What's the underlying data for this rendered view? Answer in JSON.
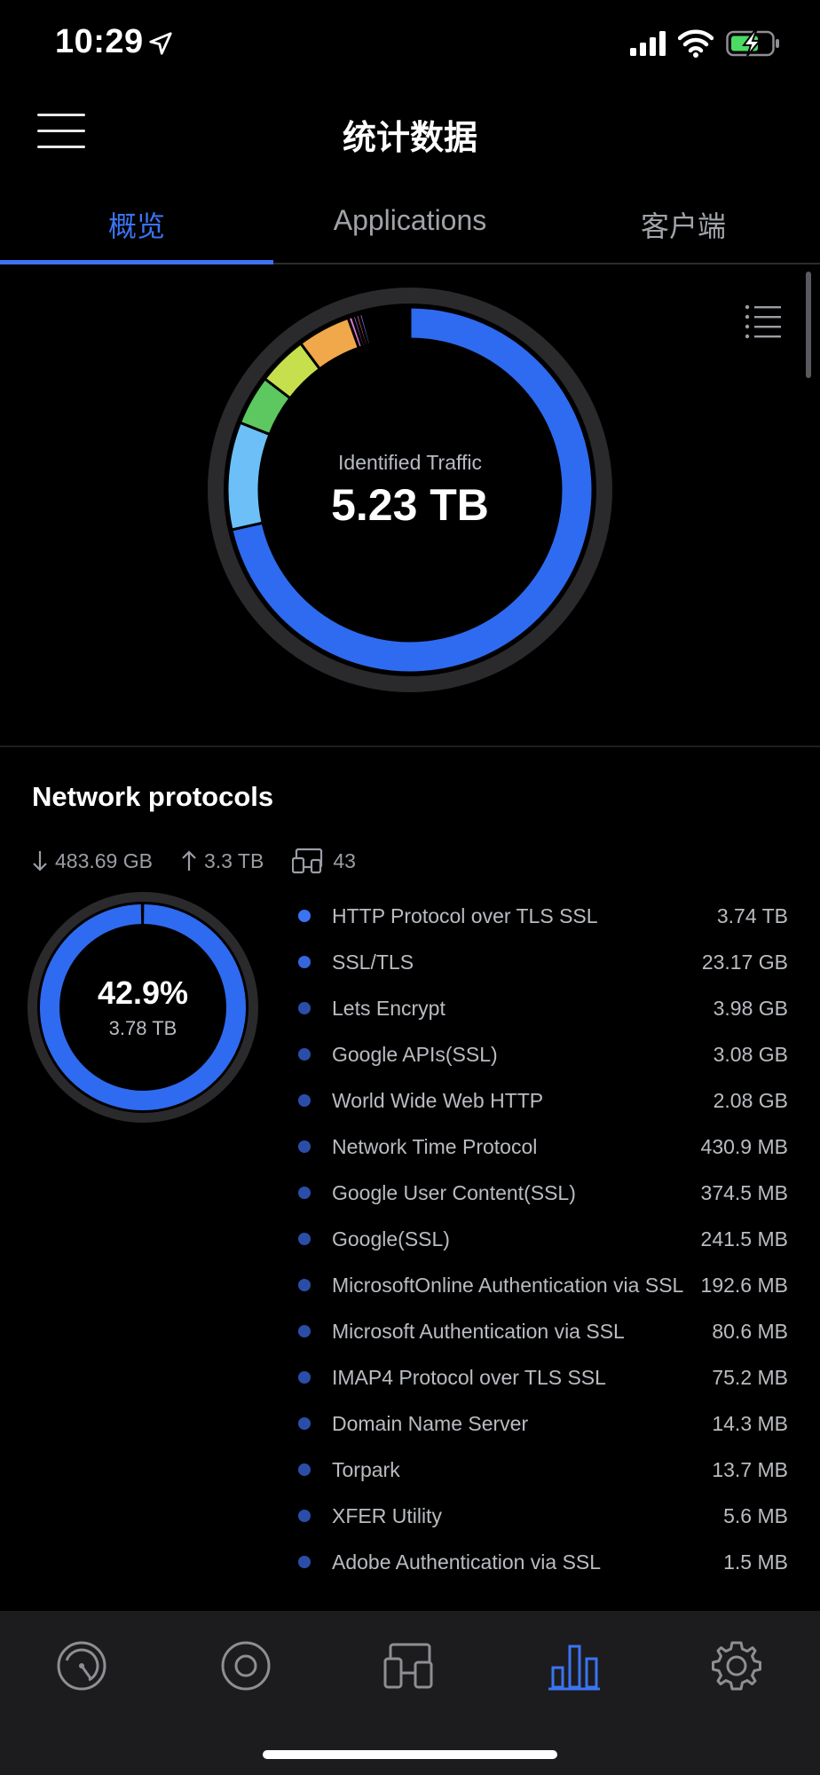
{
  "status_bar": {
    "time": "10:29",
    "icons": [
      "location-arrow-icon",
      "cellular-signal-icon",
      "wifi-icon",
      "battery-charging-icon"
    ]
  },
  "nav": {
    "title": "统计数据",
    "menu_icon": "hamburger-menu-icon"
  },
  "tabs": [
    {
      "label": "概览",
      "active": true
    },
    {
      "label": "Applications",
      "active": false
    },
    {
      "label": "客户端",
      "active": false
    }
  ],
  "overview": {
    "caption": "Identified Traffic",
    "total": "5.23 TB",
    "list_icon": "list-view-icon"
  },
  "traffic_segments": [
    {
      "fraction": 0.715,
      "color": "#2f6bf0"
    },
    {
      "fraction": 0.095,
      "color": "#6cc0f7"
    },
    {
      "fraction": 0.044,
      "color": "#5cc85f"
    },
    {
      "fraction": 0.044,
      "color": "#c6e04d"
    },
    {
      "fraction": 0.047,
      "color": "#f0a84a"
    },
    {
      "fraction": 0.004,
      "color": "#e07bd4"
    },
    {
      "fraction": 0.003,
      "color": "#9d6cf2"
    },
    {
      "fraction": 0.003,
      "color": "#f06b6b"
    },
    {
      "fraction": 0.003,
      "color": "#7a7ff0"
    }
  ],
  "network_protocols": {
    "title": "Network protocols",
    "download": "483.69 GB",
    "upload": "3.3 TB",
    "clients": "43",
    "percent": "42.9%",
    "amount": "3.78 TB",
    "donut_fraction": 0.995,
    "accent": "#2f6bf0",
    "items": [
      {
        "name": "HTTP Protocol over TLS SSL",
        "value": "3.74 TB",
        "color": "#3b74f2"
      },
      {
        "name": "SSL/TLS",
        "value": "23.17 GB",
        "color": "#3566dc"
      },
      {
        "name": "Lets Encrypt",
        "value": "3.98 GB",
        "color": "#2a4ea8"
      },
      {
        "name": "Google APIs(SSL)",
        "value": "3.08 GB",
        "color": "#2a4ea8"
      },
      {
        "name": "World Wide Web HTTP",
        "value": "2.08 GB",
        "color": "#2a4ea8"
      },
      {
        "name": "Network Time Protocol",
        "value": "430.9 MB",
        "color": "#2a4ea8"
      },
      {
        "name": "Google User Content(SSL)",
        "value": "374.5 MB",
        "color": "#2a4ea8"
      },
      {
        "name": "Google(SSL)",
        "value": "241.5 MB",
        "color": "#2a4ea8"
      },
      {
        "name": "MicrosoftOnline Authentication via SSL",
        "value": "192.6 MB",
        "color": "#2a4ea8"
      },
      {
        "name": "Microsoft Authentication via SSL",
        "value": "80.6 MB",
        "color": "#2a4ea8"
      },
      {
        "name": "IMAP4 Protocol over TLS SSL",
        "value": "75.2 MB",
        "color": "#2a4ea8"
      },
      {
        "name": "Domain Name Server",
        "value": "14.3 MB",
        "color": "#2a4ea8"
      },
      {
        "name": "Torpark",
        "value": "13.7 MB",
        "color": "#2a4ea8"
      },
      {
        "name": "XFER Utility",
        "value": "5.6 MB",
        "color": "#2a4ea8"
      },
      {
        "name": "Adobe Authentication via SSL",
        "value": "1.5 MB",
        "color": "#2a4ea8"
      }
    ]
  },
  "bottom_tabs": [
    {
      "icon": "dashboard-gauge-icon",
      "active": false
    },
    {
      "icon": "device-circle-icon",
      "active": false
    },
    {
      "icon": "clients-devices-icon",
      "active": false
    },
    {
      "icon": "statistics-bar-chart-icon",
      "active": true
    },
    {
      "icon": "settings-gear-icon",
      "active": false
    }
  ]
}
